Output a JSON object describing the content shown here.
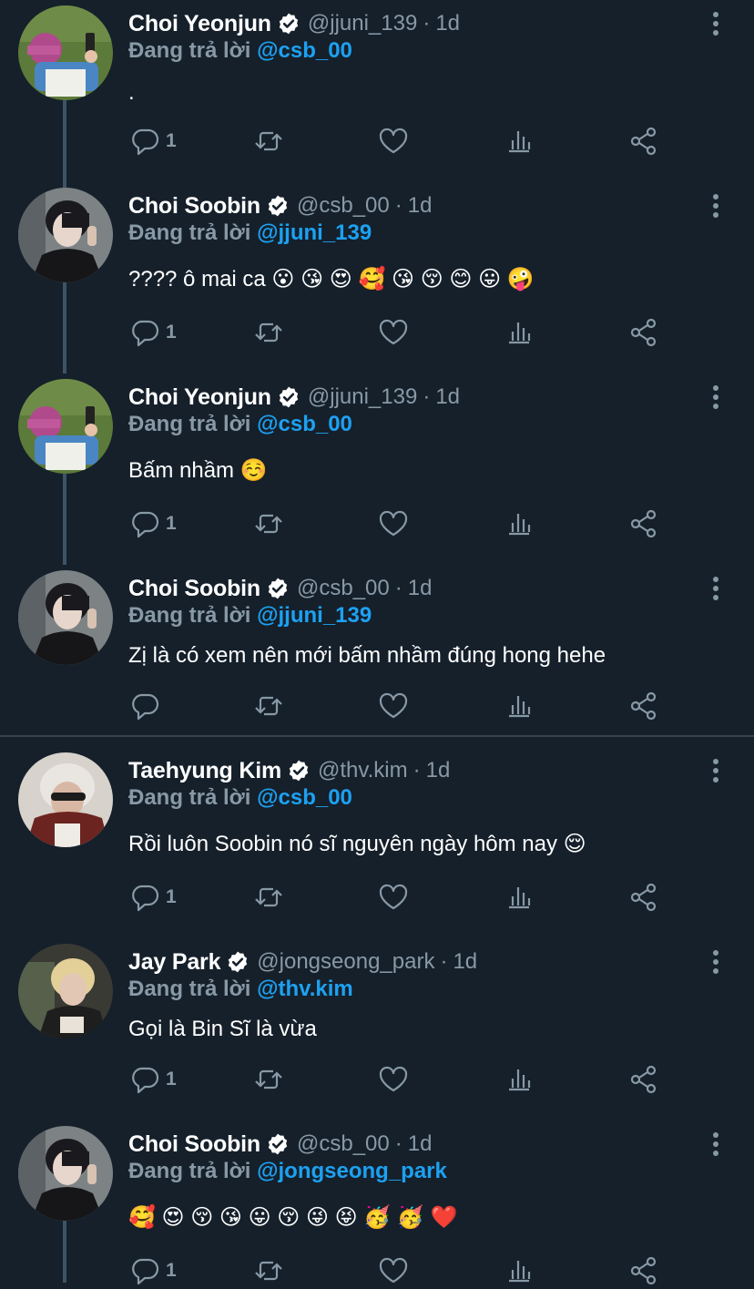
{
  "reply_prefix": "Đang trả lời",
  "tweets": [
    {
      "name": "Choi Yeonjun",
      "handle": "@jjuni_139",
      "time": "1d",
      "reply_to": "@csb_00",
      "text": ".",
      "reply_count": "1",
      "avatar": "garden-phone-photo",
      "thread_connector_below": true
    },
    {
      "name": "Choi Soobin",
      "handle": "@csb_00",
      "time": "1d",
      "reply_to": "@jjuni_139",
      "text": "???? ô mai ca 😮 😘 😍 🥰 😘 😚 😊 😛 🤪",
      "reply_count": "1",
      "avatar": "portrait-dark-hair",
      "thread_connector_below": true
    },
    {
      "name": "Choi Yeonjun",
      "handle": "@jjuni_139",
      "time": "1d",
      "reply_to": "@csb_00",
      "text": "Bấm nhầm ☺️",
      "reply_count": "1",
      "avatar": "garden-phone-photo",
      "thread_connector_below": true
    },
    {
      "name": "Choi Soobin",
      "handle": "@csb_00",
      "time": "1d",
      "reply_to": "@jjuni_139",
      "text": "Zị là có xem nên mới bấm nhầm đúng hong hehe",
      "reply_count": "",
      "avatar": "portrait-dark-hair",
      "thread_connector_below": false
    },
    {
      "name": "Taehyung Kim",
      "handle": "@thv.kim",
      "time": "1d",
      "reply_to": "@csb_00",
      "text": "Rồi luôn Soobin nó sĩ nguyên ngày hôm nay 😌",
      "reply_count": "1",
      "avatar": "sunglasses-portrait",
      "thread_connector_below": false
    },
    {
      "name": "Jay Park",
      "handle": "@jongseong_park",
      "time": "1d",
      "reply_to": "@thv.kim",
      "text": "Gọi là Bin Sĩ là vừa",
      "reply_count": "1",
      "avatar": "blond-portrait",
      "thread_connector_below": false
    },
    {
      "name": "Choi Soobin",
      "handle": "@csb_00",
      "time": "1d",
      "reply_to": "@jongseong_park",
      "text": "🥰 😍 😚 😘 😛 😚 😜 😝 🥳 🥳 ❤️",
      "reply_count": "1",
      "avatar": "portrait-dark-hair",
      "thread_connector_below": true
    }
  ],
  "icons": {
    "verified": "verified-badge-icon",
    "more": "more-vertical-icon",
    "reply": "reply-bubble-icon",
    "retweet": "retweet-icon",
    "like": "heart-icon",
    "analytics": "analytics-bars-icon",
    "share": "share-icon"
  },
  "colors": {
    "background": "#15202b",
    "secondary_text": "#8899a6",
    "mention": "#1da1f2",
    "divider": "#38444d",
    "thread_line": "#3d5466"
  }
}
